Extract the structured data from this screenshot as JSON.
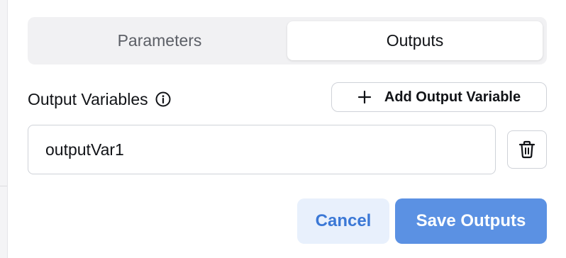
{
  "tabs": [
    {
      "label": "Parameters",
      "active": false
    },
    {
      "label": "Outputs",
      "active": true
    }
  ],
  "output_section": {
    "title": "Output Variables",
    "info_icon": "info-circle-icon",
    "add_button_label": "Add Output Variable",
    "add_button_icon": "plus-icon"
  },
  "variables": [
    {
      "value": "outputVar1",
      "delete_icon": "trash-icon"
    }
  ],
  "footer": {
    "cancel_label": "Cancel",
    "save_label": "Save Outputs"
  },
  "colors": {
    "accent": "#5b91e3",
    "cancel_bg": "#e8f0fc",
    "cancel_text": "#3b78d6"
  }
}
